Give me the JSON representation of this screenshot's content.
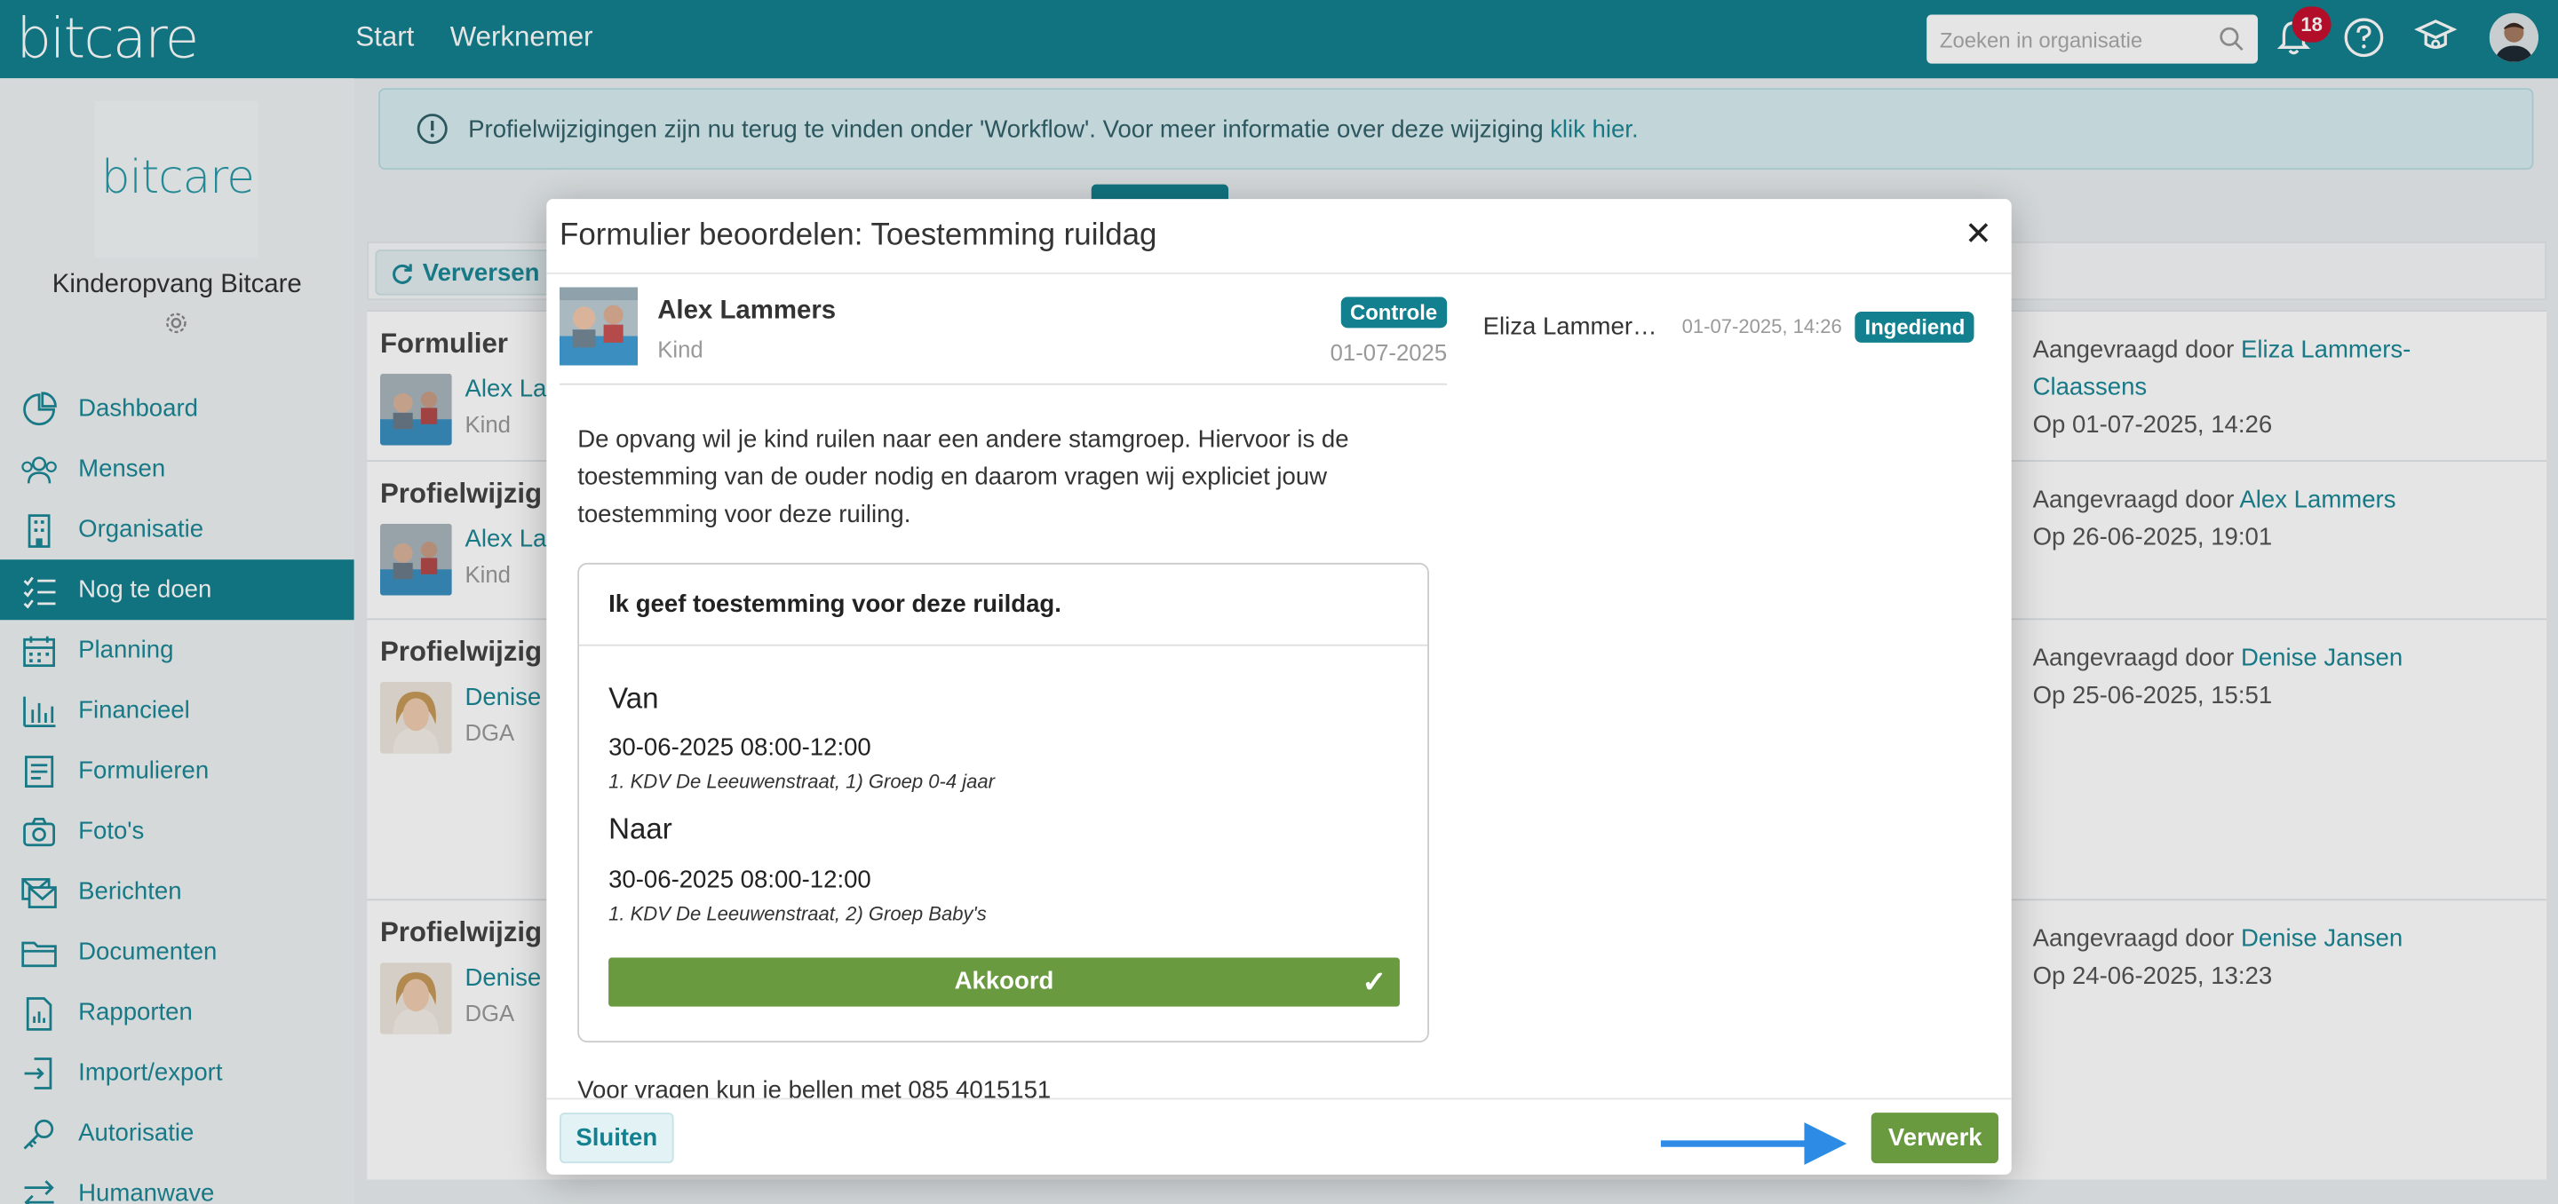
{
  "header": {
    "brand": "bitcare",
    "nav": [
      "Start",
      "Werknemer"
    ],
    "search_placeholder": "Zoeken in organisatie",
    "notification_count": "18"
  },
  "sidebar": {
    "logo_text": "bitcare",
    "org_name": "Kinderopvang Bitcare",
    "items": [
      {
        "label": "Dashboard",
        "icon": "pie-chart-icon"
      },
      {
        "label": "Mensen",
        "icon": "people-icon"
      },
      {
        "label": "Organisatie",
        "icon": "building-icon"
      },
      {
        "label": "Nog te doen",
        "icon": "checklist-icon",
        "active": true
      },
      {
        "label": "Planning",
        "icon": "calendar-icon"
      },
      {
        "label": "Financieel",
        "icon": "bar-chart-icon"
      },
      {
        "label": "Formulieren",
        "icon": "form-icon"
      },
      {
        "label": "Foto's",
        "icon": "camera-icon"
      },
      {
        "label": "Berichten",
        "icon": "messages-icon"
      },
      {
        "label": "Documenten",
        "icon": "folder-icon"
      },
      {
        "label": "Rapporten",
        "icon": "report-icon"
      },
      {
        "label": "Import/export",
        "icon": "import-icon"
      },
      {
        "label": "Autorisatie",
        "icon": "key-icon"
      },
      {
        "label": "Humanwave",
        "icon": "exchange-icon"
      }
    ]
  },
  "banner": {
    "text": "Profielwijzigingen zijn nu terug te vinden onder 'Workflow'. Voor meer informatie over deze wijziging",
    "link": "klik hier."
  },
  "toolbar": {
    "refresh_label": "Verversen"
  },
  "cards": [
    {
      "title": "Formulier",
      "name": "Alex La",
      "sub": "Kind",
      "req_prefix": "Aangevraagd door",
      "req_name": "Eliza Lammers-Claassens",
      "req_date": "Op 01-07-2025, 14:26"
    },
    {
      "title": "Profielwijzig",
      "name": "Alex La",
      "sub": "Kind",
      "req_prefix": "Aangevraagd door",
      "req_name": "Alex Lammers",
      "req_date": "Op 26-06-2025, 19:01"
    },
    {
      "title": "Profielwijzig",
      "name": "Denise",
      "sub": "DGA",
      "req_prefix": "Aangevraagd door",
      "req_name": "Denise Jansen",
      "req_date": "Op 25-06-2025, 15:51"
    },
    {
      "title": "Profielwijzig",
      "name": "Denise",
      "sub": "DGA",
      "req_prefix": "Aangevraagd door",
      "req_name": "Denise Jansen",
      "req_date": "Op 24-06-2025, 13:23"
    }
  ],
  "modal": {
    "title": "Formulier beoordelen: Toestemming ruildag",
    "person": {
      "name": "Alex Lammers",
      "role": "Kind",
      "badge": "Controle",
      "date": "01-07-2025"
    },
    "description": "De opvang wil je kind ruilen naar een andere stamgroep. Hiervoor is de toestemming van de ouder nodig en daarom vragen wij expliciet jouw toestemming voor deze ruiling.",
    "form": {
      "heading": "Ik geef toestemming voor deze ruildag.",
      "van_label": "Van",
      "van_value": "30-06-2025 08:00-12:00",
      "van_location": "1. KDV De Leeuwenstraat, 1) Groep 0-4 jaar",
      "naar_label": "Naar",
      "naar_value": "30-06-2025 08:00-12:00",
      "naar_location": "1. KDV De Leeuwenstraat, 2) Groep Baby's",
      "akkoord_label": "Akkoord",
      "akkoord_check": "✓"
    },
    "cut_text": "Voor vragen kun je bellen met 085 4015151",
    "submission": {
      "name": "Eliza Lammers-Claassens",
      "time": "01-07-2025, 14:26",
      "badge": "Ingediend"
    },
    "buttons": {
      "close": "Sluiten",
      "process": "Verwerk"
    }
  },
  "colors": {
    "primary": "#12808e",
    "accent_green": "#6a9a3f",
    "badge_red": "#c8102e",
    "arrow_blue": "#2d8be6"
  }
}
